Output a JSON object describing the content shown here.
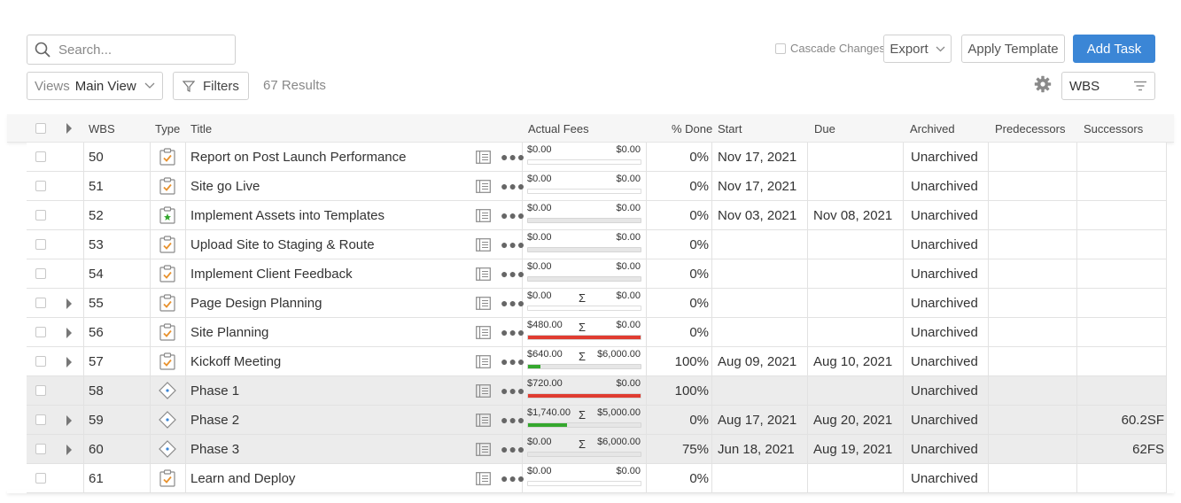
{
  "toolbar": {
    "search_placeholder": "Search...",
    "views_label": "Views",
    "views_value": "Main View",
    "filters_label": "Filters",
    "results": "67 Results",
    "cascade_label": "Cascade Changes",
    "export_label": "Export",
    "apply_template_label": "Apply Template",
    "add_task_label": "Add Task",
    "sort_value": "WBS"
  },
  "columns": {
    "wbs": "WBS",
    "type": "Type",
    "title": "Title",
    "actual_fees": "Actual Fees",
    "pct_done": "% Done",
    "start": "Start",
    "due": "Due",
    "archived": "Archived",
    "predecessors": "Predecessors",
    "successors": "Successors"
  },
  "colors": {
    "accent": "#3b86d6",
    "over_budget": "#e03c31",
    "progress": "#35a82e",
    "task_icon": "#e8922e"
  },
  "rows": [
    {
      "wbs": "50",
      "type": "task-icon",
      "title": "Report on Post Launch Performance",
      "fee_actual": "$0.00",
      "fee_budget": "$0.00",
      "sigma": "",
      "bar_color": "",
      "bar_fraction": 0,
      "bar_style": "clean",
      "pct": "0%",
      "start": "Nov 17, 2021",
      "due": "",
      "archived": "Unarchived",
      "successors": "",
      "expandable": false,
      "gray": false
    },
    {
      "wbs": "51",
      "type": "task-icon",
      "title": "Site go Live",
      "fee_actual": "$0.00",
      "fee_budget": "$0.00",
      "sigma": "",
      "bar_color": "",
      "bar_fraction": 0,
      "bar_style": "clean",
      "pct": "0%",
      "start": "Nov 17, 2021",
      "due": "",
      "archived": "Unarchived",
      "successors": "",
      "expandable": false,
      "gray": false
    },
    {
      "wbs": "52",
      "type": "milestone-task-icon",
      "title": "Implement Assets into Templates",
      "fee_actual": "$0.00",
      "fee_budget": "$0.00",
      "sigma": "",
      "bar_color": "",
      "bar_fraction": 0,
      "bar_style": "filled",
      "pct": "0%",
      "start": "Nov 03, 2021",
      "due": "Nov 08, 2021",
      "archived": "Unarchived",
      "successors": "",
      "expandable": false,
      "gray": false
    },
    {
      "wbs": "53",
      "type": "task-icon",
      "title": "Upload Site to Staging & Route",
      "fee_actual": "$0.00",
      "fee_budget": "$0.00",
      "sigma": "",
      "bar_color": "",
      "bar_fraction": 0,
      "bar_style": "filled",
      "pct": "0%",
      "start": "",
      "due": "",
      "archived": "Unarchived",
      "successors": "",
      "expandable": false,
      "gray": false
    },
    {
      "wbs": "54",
      "type": "task-icon",
      "title": "Implement Client Feedback",
      "fee_actual": "$0.00",
      "fee_budget": "$0.00",
      "sigma": "",
      "bar_color": "",
      "bar_fraction": 0,
      "bar_style": "filled",
      "pct": "0%",
      "start": "",
      "due": "",
      "archived": "Unarchived",
      "successors": "",
      "expandable": false,
      "gray": false
    },
    {
      "wbs": "55",
      "type": "task-icon",
      "title": "Page Design Planning",
      "fee_actual": "$0.00",
      "fee_budget": "$0.00",
      "sigma": "Σ",
      "bar_color": "",
      "bar_fraction": 0,
      "bar_style": "clean",
      "pct": "0%",
      "start": "",
      "due": "",
      "archived": "Unarchived",
      "successors": "",
      "expandable": true,
      "gray": false
    },
    {
      "wbs": "56",
      "type": "task-icon",
      "title": "Site Planning",
      "fee_actual": "$480.00",
      "fee_budget": "$0.00",
      "sigma": "Σ",
      "bar_color": "#e03c31",
      "bar_fraction": 1,
      "bar_style": "filled",
      "pct": "0%",
      "start": "",
      "due": "",
      "archived": "Unarchived",
      "successors": "",
      "expandable": true,
      "gray": false
    },
    {
      "wbs": "57",
      "type": "task-icon",
      "title": "Kickoff Meeting",
      "fee_actual": "$640.00",
      "fee_budget": "$6,000.00",
      "sigma": "Σ",
      "bar_color": "#35a82e",
      "bar_fraction": 0.107,
      "bar_style": "filled",
      "pct": "100%",
      "start": "Aug 09, 2021",
      "due": "Aug 10, 2021",
      "archived": "Unarchived",
      "successors": "",
      "expandable": true,
      "gray": false
    },
    {
      "wbs": "58",
      "type": "phase-icon",
      "title": "Phase 1",
      "fee_actual": "$720.00",
      "fee_budget": "$0.00",
      "sigma": "",
      "bar_color": "#e03c31",
      "bar_fraction": 1,
      "bar_style": "filled",
      "pct": "100%",
      "start": "",
      "due": "",
      "archived": "Unarchived",
      "successors": "",
      "expandable": false,
      "gray": true
    },
    {
      "wbs": "59",
      "type": "phase-icon",
      "title": "Phase 2",
      "fee_actual": "$1,740.00",
      "fee_budget": "$5,000.00",
      "sigma": "Σ",
      "bar_color": "#35a82e",
      "bar_fraction": 0.348,
      "bar_style": "filled",
      "pct": "0%",
      "start": "Aug 17, 2021",
      "due": "Aug 20, 2021",
      "archived": "Unarchived",
      "successors": "60.2SF",
      "expandable": true,
      "gray": true
    },
    {
      "wbs": "60",
      "type": "phase-icon",
      "title": "Phase 3",
      "fee_actual": "$0.00",
      "fee_budget": "$6,000.00",
      "sigma": "Σ",
      "bar_color": "",
      "bar_fraction": 0,
      "bar_style": "filled",
      "pct": "75%",
      "start": "Jun 18, 2021",
      "due": "Aug 19, 2021",
      "archived": "Unarchived",
      "successors": "62FS",
      "expandable": true,
      "gray": true
    },
    {
      "wbs": "61",
      "type": "task-icon",
      "title": "Learn and Deploy",
      "fee_actual": "$0.00",
      "fee_budget": "$0.00",
      "sigma": "",
      "bar_color": "",
      "bar_fraction": 0,
      "bar_style": "clean",
      "pct": "0%",
      "start": "",
      "due": "",
      "archived": "Unarchived",
      "successors": "",
      "expandable": false,
      "gray": false
    }
  ]
}
